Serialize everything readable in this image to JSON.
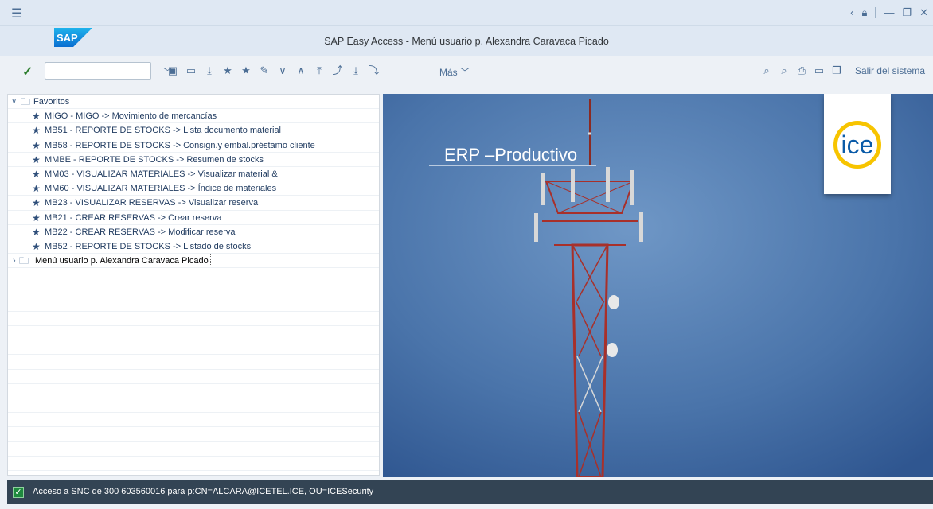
{
  "topbar": {
    "menu_icon": "hamburger-icon",
    "window_controls": [
      "back-icon",
      "lock-icon",
      "minimize-icon",
      "restore-icon",
      "close-icon"
    ]
  },
  "titlebar": {
    "logo_text": "SAP",
    "title": "SAP Easy Access  -  Menú usuario p. Alexandra Caravaca Picado"
  },
  "toolbar": {
    "command_field_value": "",
    "icons": [
      "display-icon",
      "other-menu-icon",
      "download-icon",
      "add-favorite-icon",
      "change-favorite-icon",
      "edit-icon",
      "expand-icon",
      "collapse-icon",
      "move-up-icon",
      "move-up-alt-icon",
      "move-down-icon",
      "move-down-alt-icon"
    ],
    "more_label": "Más",
    "right_icons": [
      "search-icon",
      "search-next-icon",
      "print-icon",
      "customize-icon",
      "new-window-icon"
    ],
    "exit_label": "Salir del sistema"
  },
  "tree": {
    "favorites_label": "Favoritos",
    "favorites": [
      "MIGO - MIGO -> Movimiento de mercancías",
      "MB51 - REPORTE DE STOCKS -> Lista documento material",
      "MB58 - REPORTE DE STOCKS -> Consign.y embal.préstamo cliente",
      "MMBE - REPORTE DE STOCKS -> Resumen de stocks",
      "MM03 - VISUALIZAR MATERIALES -> Visualizar material &",
      "MM60 - VISUALIZAR MATERIALES -> Índice de materiales",
      "MB23 - VISUALIZAR RESERVAS -> Visualizar reserva",
      "MB21 - CREAR RESERVAS -> Crear reserva",
      "MB22 - CREAR RESERVAS -> Modificar reserva",
      "MB52 - REPORTE DE STOCKS -> Listado de stocks"
    ],
    "user_menu_label": "Menú usuario p. Alexandra Caravaca Picado"
  },
  "banner": {
    "title": "ERP –Productivo",
    "logo_text": "ice"
  },
  "statusbar": {
    "message": "Acceso a SNC de 300 603560016 para p:CN=ALCARA@ICETEL.ICE, OU=ICESecurity"
  }
}
